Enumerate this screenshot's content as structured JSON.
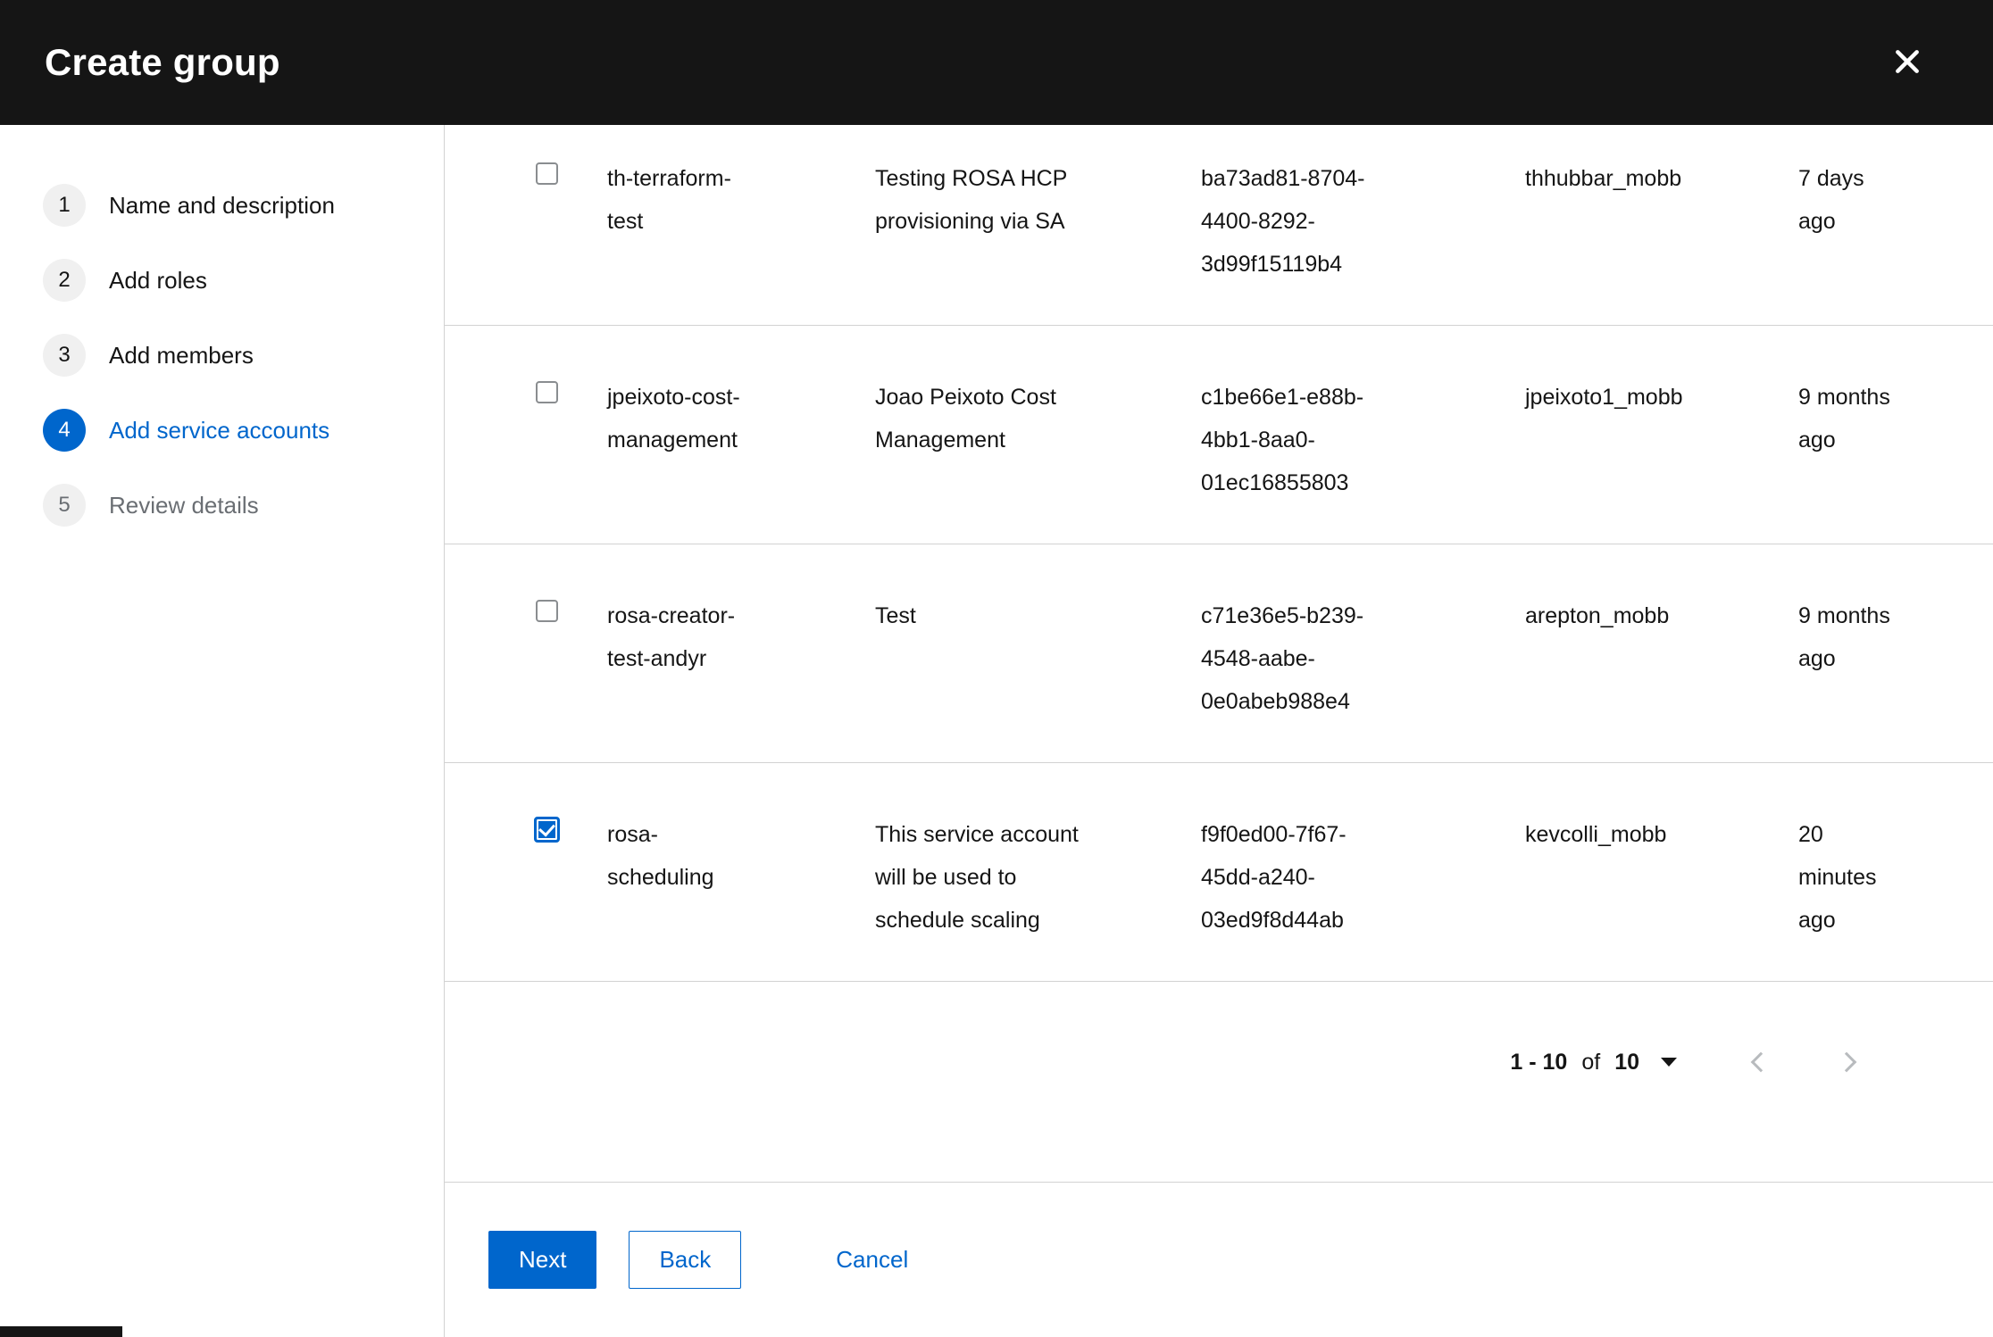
{
  "header": {
    "title": "Create group"
  },
  "wizard": {
    "steps": [
      {
        "number": "1",
        "label": "Name and description",
        "state": "visited"
      },
      {
        "number": "2",
        "label": "Add roles",
        "state": "visited"
      },
      {
        "number": "3",
        "label": "Add members",
        "state": "visited"
      },
      {
        "number": "4",
        "label": "Add service accounts",
        "state": "current"
      },
      {
        "number": "5",
        "label": "Review details",
        "state": "upcoming"
      }
    ]
  },
  "table": {
    "rows": [
      {
        "checked": false,
        "name": "th-terraform-test",
        "description": "Testing ROSA HCP provisioning via SA",
        "client_id": "ba73ad81-8704-4400-8292-3d99f15119b4",
        "owner": "thhubbar_mobb",
        "created": "7 days ago"
      },
      {
        "checked": false,
        "name": "jpeixoto-cost-management",
        "description": "Joao Peixoto Cost Management",
        "client_id": "c1be66e1-e88b-4bb1-8aa0-01ec16855803",
        "owner": "jpeixoto1_mobb",
        "created": "9 months ago"
      },
      {
        "checked": false,
        "name": "rosa-creator-test-andyr",
        "description": "Test",
        "client_id": "c71e36e5-b239-4548-aabe-0e0abeb988e4",
        "owner": "arepton_mobb",
        "created": "9 months ago"
      },
      {
        "checked": true,
        "name": "rosa-scheduling",
        "description": "This service account will be used to schedule scaling",
        "client_id": "f9f0ed00-7f67-45dd-a240-03ed9f8d44ab",
        "owner": "kevcolli_mobb",
        "created": "20 minutes ago"
      }
    ]
  },
  "pagination": {
    "range": "1 - 10",
    "of": "of",
    "total": "10"
  },
  "footer": {
    "next": "Next",
    "back": "Back",
    "cancel": "Cancel"
  },
  "colors": {
    "accent": "#0066cc",
    "header_bg": "#151515",
    "border": "#d2d2d2"
  }
}
